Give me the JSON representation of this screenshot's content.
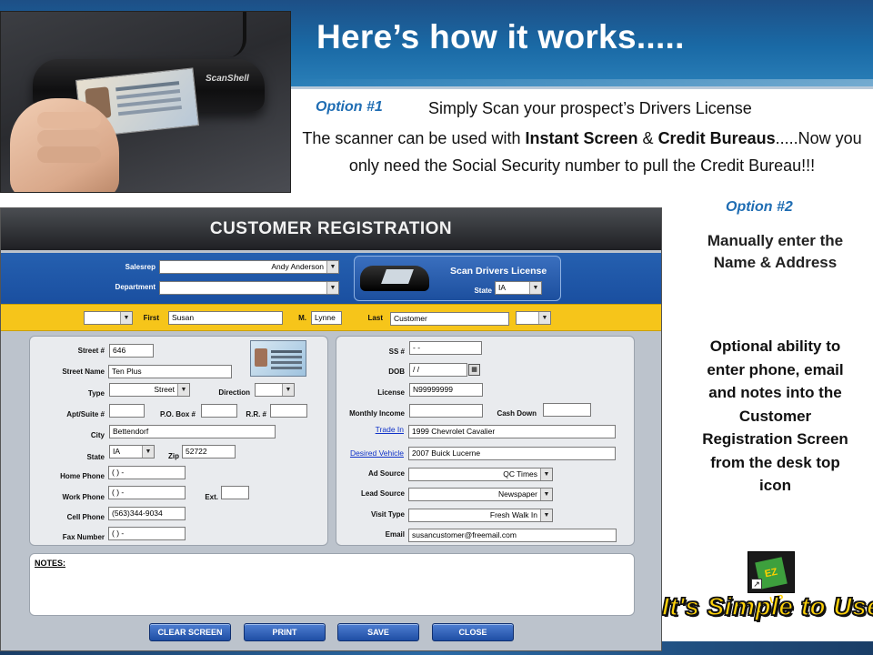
{
  "slide": {
    "title": "Here’s how it works.....",
    "option1_label": "Option #1",
    "option1_text": "Simply Scan your prospect’s Drivers License",
    "scan_desc_1": "The scanner can be used with ",
    "scan_desc_bold_1": "Instant Screen",
    "scan_desc_2": " & ",
    "scan_desc_bold_2": "Credit Bureaus",
    "scan_desc_3": ".....Now you only need the Social Security number to pull the Credit Bureau!!!",
    "option2_label": "Option #2",
    "option2_text": "Manually enter the Name & Address",
    "optional_text": "Optional ability to enter phone, email and notes into the Customer Registration Screen from the desk top icon",
    "simple_text": "It's Simple to Use!",
    "scanner_brand": "ScanShell",
    "icon_label": "EZ UP"
  },
  "app": {
    "title": "CUSTOMER REGISTRATION",
    "scan_button_label": "Scan Drivers License",
    "labels": {
      "salesrep": "Salesrep",
      "department": "Department",
      "state_top": "State",
      "first": "First",
      "m": "M.",
      "last": "Last",
      "street_no": "Street #",
      "street_name": "Street Name",
      "type": "Type",
      "direction": "Direction",
      "apt": "Apt/Suite #",
      "po_box": "P.O. Box #",
      "rr": "R.R. #",
      "city": "City",
      "state": "State",
      "zip": "Zip",
      "home_phone": "Home Phone",
      "work_phone": "Work Phone",
      "ext": "Ext.",
      "cell_phone": "Cell Phone",
      "fax_number": "Fax Number",
      "ss": "SS #",
      "dob": "DOB",
      "license": "License",
      "monthly_income": "Monthly Income",
      "cash_down": "Cash Down",
      "trade_in": "Trade In",
      "desired_vehicle": "Desired Vehicle",
      "ad_source": "Ad Source",
      "lead_source": "Lead Source",
      "visit_type": "Visit Type",
      "email": "Email",
      "notes": "NOTES:"
    },
    "values": {
      "salesrep": "Andy Anderson",
      "state_top": "IA",
      "first": "Susan",
      "m": "Lynne",
      "last": "Customer",
      "street_no": "646",
      "street_name": "Ten Plus",
      "type": "Street",
      "city": "Bettendorf",
      "state": "IA",
      "zip": "52722",
      "home_phone": "(   )    -",
      "work_phone": "(   )    -",
      "cell_phone": "(563)344-9034",
      "fax_number": "(   )    -",
      "ss": "  -  -",
      "dob": " /  /",
      "license": "N99999999",
      "trade_in": "1999 Chevrolet Cavalier",
      "desired_vehicle": "2007 Buick Lucerne",
      "ad_source": "QC Times",
      "lead_source": "Newspaper",
      "visit_type": "Fresh Walk In",
      "email": "susancustomer@freemail.com"
    },
    "buttons": {
      "clear": "CLEAR SCREEN",
      "print": "PRINT",
      "save": "SAVE",
      "close": "CLOSE"
    }
  },
  "icons": {
    "dropdown": "chevron-down-icon",
    "calendar": "calendar-icon",
    "shortcut": "shortcut-arrow-icon"
  },
  "colors": {
    "header_blue": "#1d4f86",
    "option_blue": "#1f6db3",
    "band_yellow": "#f6c51a",
    "form_blue": "#1a4fa0",
    "simple_yellow": "#ffd20a"
  }
}
